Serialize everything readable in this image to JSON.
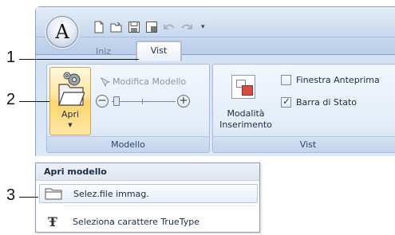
{
  "app": {
    "logo_letter": "A"
  },
  "quick_access": {
    "icons": [
      "new-document-icon",
      "open-folder-icon",
      "save-icon",
      "print-preview-icon",
      "undo-icon",
      "redo-icon"
    ],
    "customize_arrow": "▾"
  },
  "tabs": {
    "hidden_label": "Iniz",
    "active_label": "Vist"
  },
  "groups": {
    "modello": {
      "label": "Modello",
      "apri_label": "Apri",
      "modifica_label": "Modifica Modello",
      "zoom_out": "−",
      "zoom_in": "+"
    },
    "vist": {
      "label": "Vist",
      "modalita_label_1": "Modalità",
      "modalita_label_2": "Inserimento",
      "finestra_label": "Finestra Anteprima",
      "finestra_checked": false,
      "barra_label": "Barra di Stato",
      "barra_checked": true
    }
  },
  "menu": {
    "header": "Apri modello",
    "items": [
      {
        "label": "Selez.file immag.",
        "icon": "folder-icon"
      },
      {
        "label": "Seleziona carattere TrueType",
        "icon": "truetype-icon"
      }
    ]
  },
  "callouts": [
    "1",
    "2",
    "3"
  ]
}
